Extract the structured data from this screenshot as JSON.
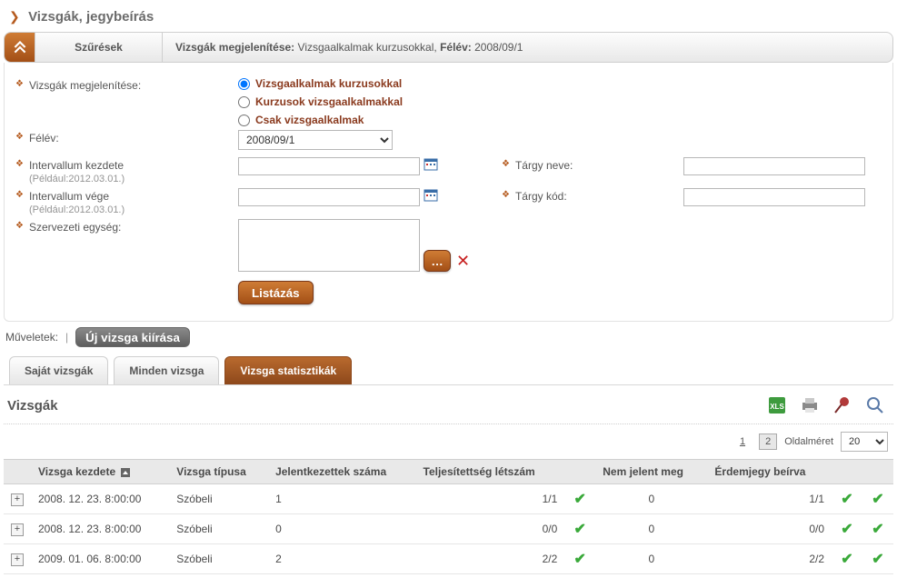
{
  "page_title": "Vizsgák, jegybeírás",
  "filter_bar": {
    "label": "Szűrések",
    "prefix": "Vizsgák megjelenítése: ",
    "value": "Vizsgaalkalmak kurzusokkal, ",
    "term_label": "Félév: ",
    "term_value": "2008/09/1"
  },
  "form": {
    "display_label": "Vizsgák megjelenítése:",
    "radios": {
      "r1": "Vizsgaalkalmak kurzusokkal",
      "r2": "Kurzusok vizsgaalkalmakkal",
      "r3": "Csak vizsgaalkalmak"
    },
    "term_label": "Félév:",
    "term_selected": "2008/09/1",
    "interval_start_label": "Intervallum kezdete",
    "interval_start_hint": "(Például:2012.03.01.)",
    "interval_start_value": "",
    "interval_end_label": "Intervallum vége",
    "interval_end_hint": "(Például:2012.03.01.)",
    "interval_end_value": "",
    "org_unit_label": "Szervezeti egység:",
    "org_unit_value": "",
    "subject_name_label": "Tárgy neve:",
    "subject_name_value": "",
    "subject_code_label": "Tárgy kód:",
    "subject_code_value": "",
    "list_button": "Listázás"
  },
  "ops": {
    "label": "Műveletek:",
    "new_exam": "Új vizsga kiírása"
  },
  "tabs": {
    "t1": "Saját vizsgák",
    "t2": "Minden vizsga",
    "t3": "Vizsga statisztikák"
  },
  "list_title": "Vizsgák",
  "pager": {
    "page1": "1",
    "page2": "2",
    "size_label": "Oldalméret",
    "size_value": "20"
  },
  "columns": {
    "c1": "Vizsga kezdete",
    "c2": "Vizsga típusa",
    "c3": "Jelentkezettek száma",
    "c4": "Teljesítettség létszám",
    "c5": "Nem jelent meg",
    "c6": "Érdemjegy beírva"
  },
  "rows": [
    {
      "date": "2008. 12. 23. 8:00:00",
      "type": "Szóbeli",
      "applicants": "1",
      "completion": "1/1",
      "completion_ok": true,
      "noshow": "0",
      "grade": "1/1",
      "grade_ok": true,
      "row_ok": true
    },
    {
      "date": "2008. 12. 23. 8:00:00",
      "type": "Szóbeli",
      "applicants": "0",
      "completion": "0/0",
      "completion_ok": true,
      "noshow": "0",
      "grade": "0/0",
      "grade_ok": true,
      "row_ok": true
    },
    {
      "date": "2009. 01. 06. 8:00:00",
      "type": "Szóbeli",
      "applicants": "2",
      "completion": "2/2",
      "completion_ok": true,
      "noshow": "0",
      "grade": "2/2",
      "grade_ok": true,
      "row_ok": true
    }
  ]
}
